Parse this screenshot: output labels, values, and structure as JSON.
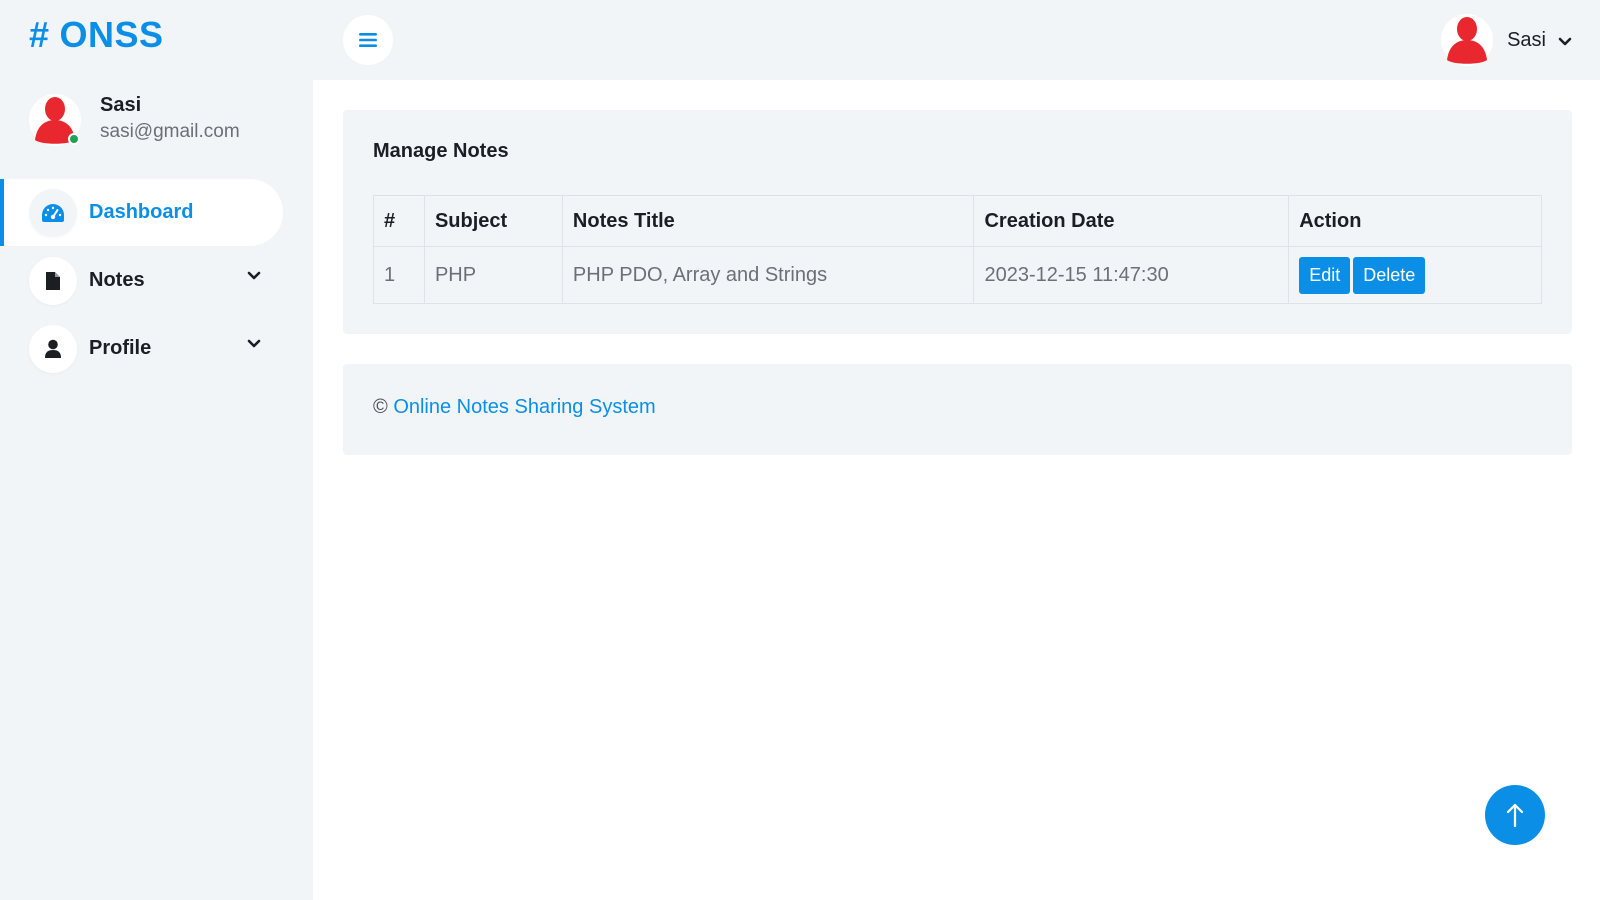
{
  "brand": {
    "symbol": "#",
    "name": "ONSS"
  },
  "user": {
    "name": "Sasi",
    "email": "sasi@gmail.com"
  },
  "nav": [
    {
      "label": "Dashboard",
      "icon": "dashboard-gauge-icon",
      "active": true
    },
    {
      "label": "Notes",
      "icon": "file-icon",
      "has_submenu": true
    },
    {
      "label": "Profile",
      "icon": "user-icon",
      "has_submenu": true
    }
  ],
  "topbar": {
    "user_name": "Sasi"
  },
  "main": {
    "card_title": "Manage Notes",
    "table": {
      "headers": [
        "#",
        "Subject",
        "Notes Title",
        "Creation Date",
        "Action"
      ],
      "rows": [
        {
          "num": "1",
          "subject": "PHP",
          "title": "PHP PDO, Array and Strings",
          "date": "2023-12-15 11:47:30",
          "edit_label": "Edit",
          "delete_label": "Delete"
        }
      ]
    }
  },
  "footer": {
    "copyright": "©",
    "link_text": "Online Notes Sharing System"
  },
  "colors": {
    "accent": "#0b8fe6",
    "avatar": "#e8282e",
    "online": "#21a153",
    "background": "#f2f5f8"
  }
}
